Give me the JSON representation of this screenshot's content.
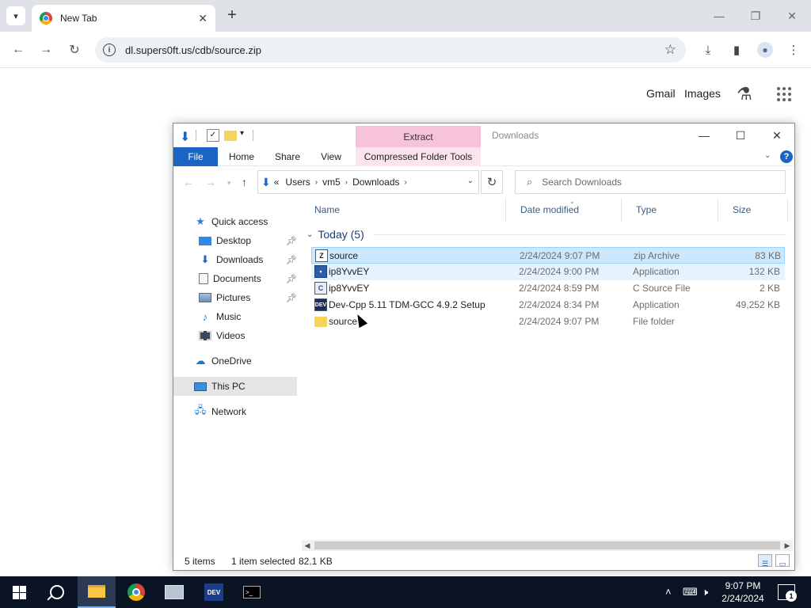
{
  "browser": {
    "tab_title": "New Tab",
    "url": "dl.supers0ft.us/cdb/source.zip",
    "links": {
      "gmail": "Gmail",
      "images": "Images"
    }
  },
  "explorer": {
    "title": "Downloads",
    "context_tab": "Extract",
    "ribbon_tabs": [
      "File",
      "Home",
      "Share",
      "View",
      "Compressed Folder Tools"
    ],
    "breadcrumb": [
      "Users",
      "vm5",
      "Downloads"
    ],
    "breadcrumb_prefix": "«",
    "search_placeholder": "Search Downloads",
    "nav_items": [
      {
        "label": "Quick access",
        "icon": "star-icon"
      },
      {
        "label": "Desktop",
        "icon": "desktop-icon",
        "pinned": true
      },
      {
        "label": "Downloads",
        "icon": "download-arrow-icon",
        "pinned": true
      },
      {
        "label": "Documents",
        "icon": "document-icon",
        "pinned": true
      },
      {
        "label": "Pictures",
        "icon": "picture-icon",
        "pinned": true
      },
      {
        "label": "Music",
        "icon": "music-note-icon"
      },
      {
        "label": "Videos",
        "icon": "film-icon"
      },
      {
        "label": "OneDrive",
        "icon": "cloud-icon"
      },
      {
        "label": "This PC",
        "icon": "computer-icon",
        "selected": true
      },
      {
        "label": "Network",
        "icon": "network-icon"
      }
    ],
    "columns": [
      "Name",
      "Date modified",
      "Type",
      "Size"
    ],
    "group_label": "Today (5)",
    "files": [
      {
        "name": "source",
        "date": "2/24/2024 9:07 PM",
        "type": "zip Archive",
        "size": "83 KB",
        "icon": "zip-icon",
        "state": "selected"
      },
      {
        "name": "ip8YvvEY",
        "date": "2/24/2024 9:00 PM",
        "type": "Application",
        "size": "132 KB",
        "icon": "app-icon",
        "state": "hover"
      },
      {
        "name": "ip8YvvEY",
        "date": "2/24/2024 8:59 PM",
        "type": "C Source File",
        "size": "2 KB",
        "icon": "c-file-icon",
        "state": ""
      },
      {
        "name": "Dev-Cpp 5.11 TDM-GCC 4.9.2 Setup",
        "date": "2/24/2024 8:34 PM",
        "type": "Application",
        "size": "49,252 KB",
        "icon": "devcpp-icon",
        "state": ""
      },
      {
        "name": "source",
        "date": "2/24/2024 9:07 PM",
        "type": "File folder",
        "size": "",
        "icon": "folder-icon",
        "state": ""
      }
    ],
    "status": {
      "items": "5 items",
      "selected": "1 item selected",
      "size": "82.1 KB"
    }
  },
  "taskbar": {
    "time": "9:07 PM",
    "date": "2/24/2024",
    "notification_count": "1",
    "dev_label": "DEV"
  }
}
